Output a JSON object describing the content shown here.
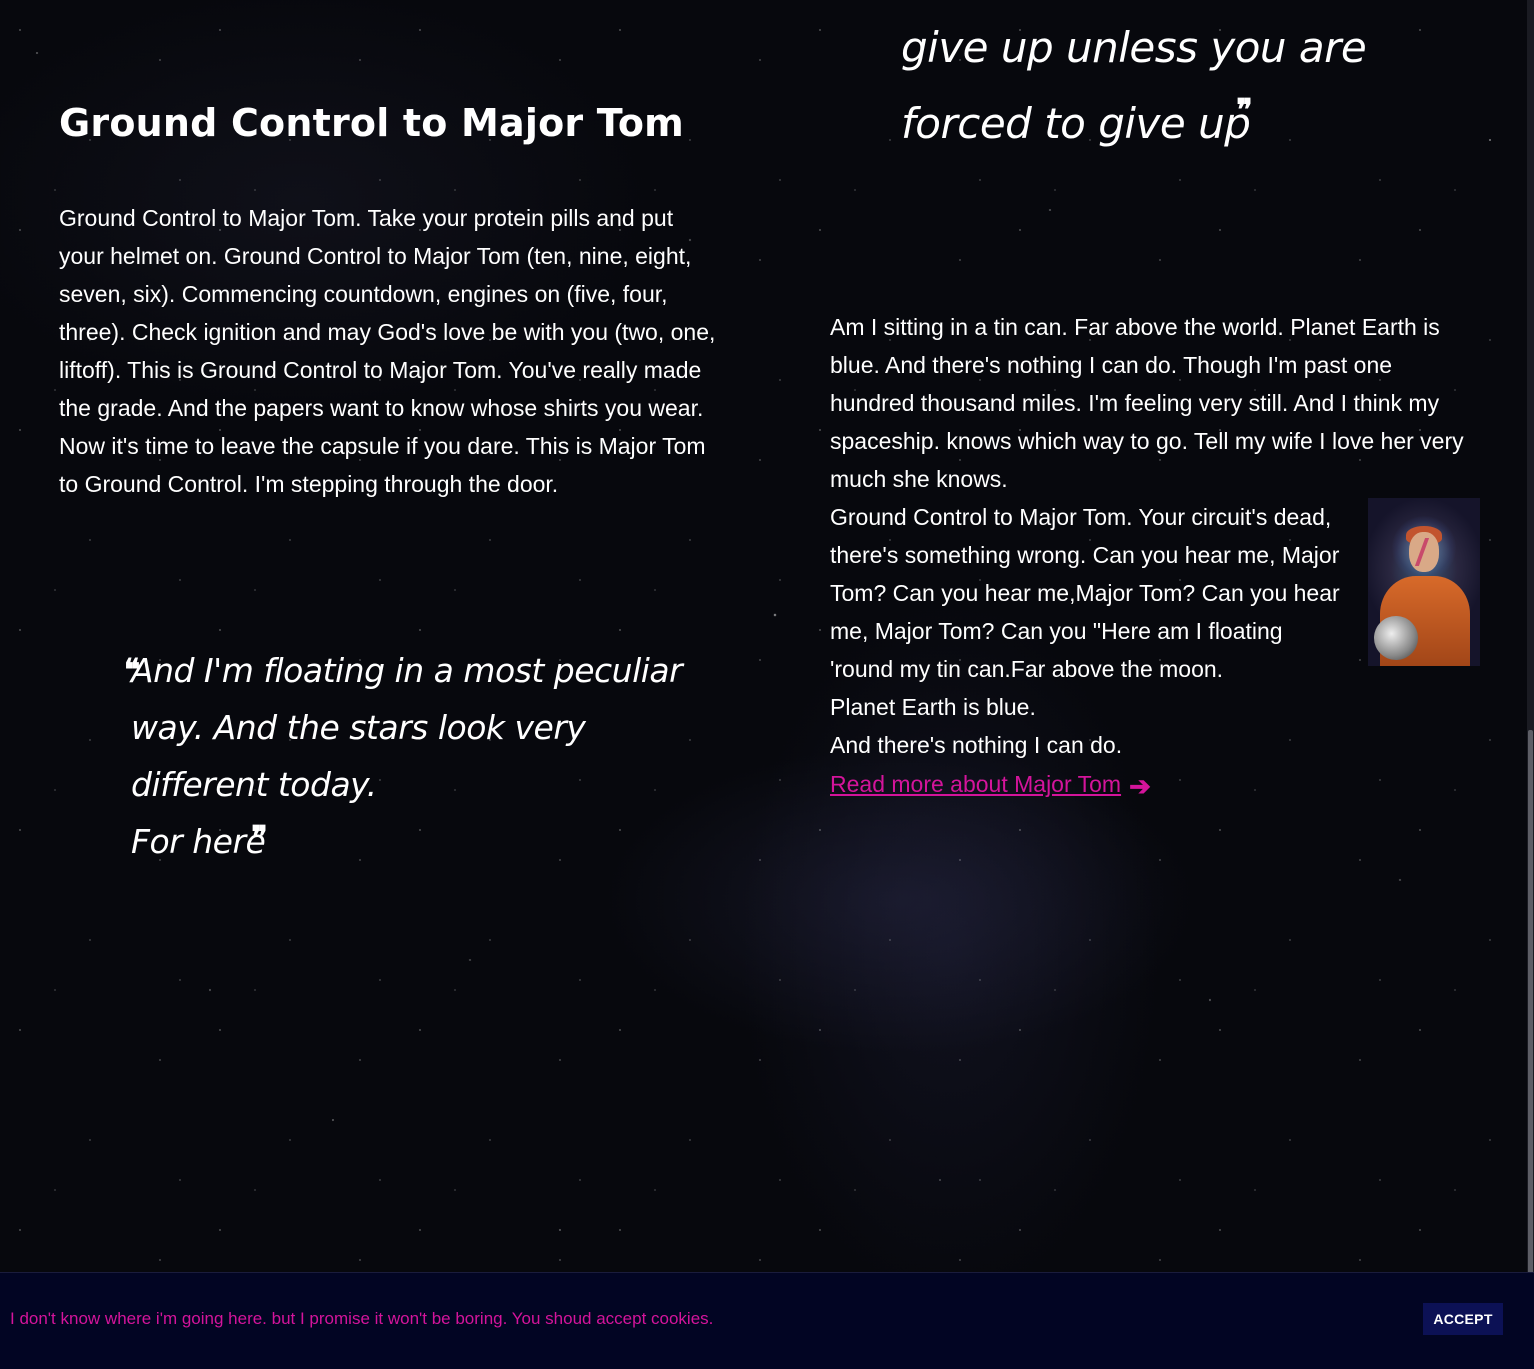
{
  "left_section": {
    "title": "Ground Control to Major Tom",
    "paragraph": "Ground Control to Major Tom. Take your protein pills and put your helmet on. Ground Control to Major Tom (ten, nine, eight, seven, six). Commencing countdown, engines on (five, four, three). Check ignition and may God's love be with you (two, one, liftoff). This is Ground Control to Major Tom. You've really made the grade. And the papers want to know whose shirts you wear. Now it's time to leave the capsule if you dare. This is Major Tom to Ground Control. I'm stepping through the door.",
    "quote_line1": "And I'm floating in a most peculiar way. And the stars look very different today.",
    "quote_line2": "For here"
  },
  "right_section": {
    "quote_text": "give up unless you are forced to give up",
    "paragraph1": "Am I sitting in a tin can. Far above the world. Planet Earth is blue. And there's nothing I can do. Though I'm past one hundred thousand miles. I'm feeling very still. And I think my spaceship. knows which way to go. Tell my wife I love her very much she knows.",
    "paragraph2": "Ground Control to Major Tom. Your circuit's dead, there's something wrong. Can you hear me, Major Tom? Can you hear me,Major Tom? Can you hear me, Major Tom? Can you \"Here am I floating 'round my tin can.Far above the moon.",
    "paragraph3": "Planet Earth is blue.",
    "paragraph4": "And there's nothing I can do.",
    "read_more_label": "Read more about Major Tom",
    "image_icon": "astronaut-portrait"
  },
  "quote_marks": {
    "open": "❝",
    "close": "❞"
  },
  "cookie_banner": {
    "message": "I don't know where i'm going here. but I promise it won't be boring. You shoud accept cookies.",
    "accept_label": "ACCEPT"
  },
  "colors": {
    "accent": "#d4149b",
    "banner_bg": "#020523",
    "button_bg": "#0c1155",
    "text": "#ffffff"
  }
}
